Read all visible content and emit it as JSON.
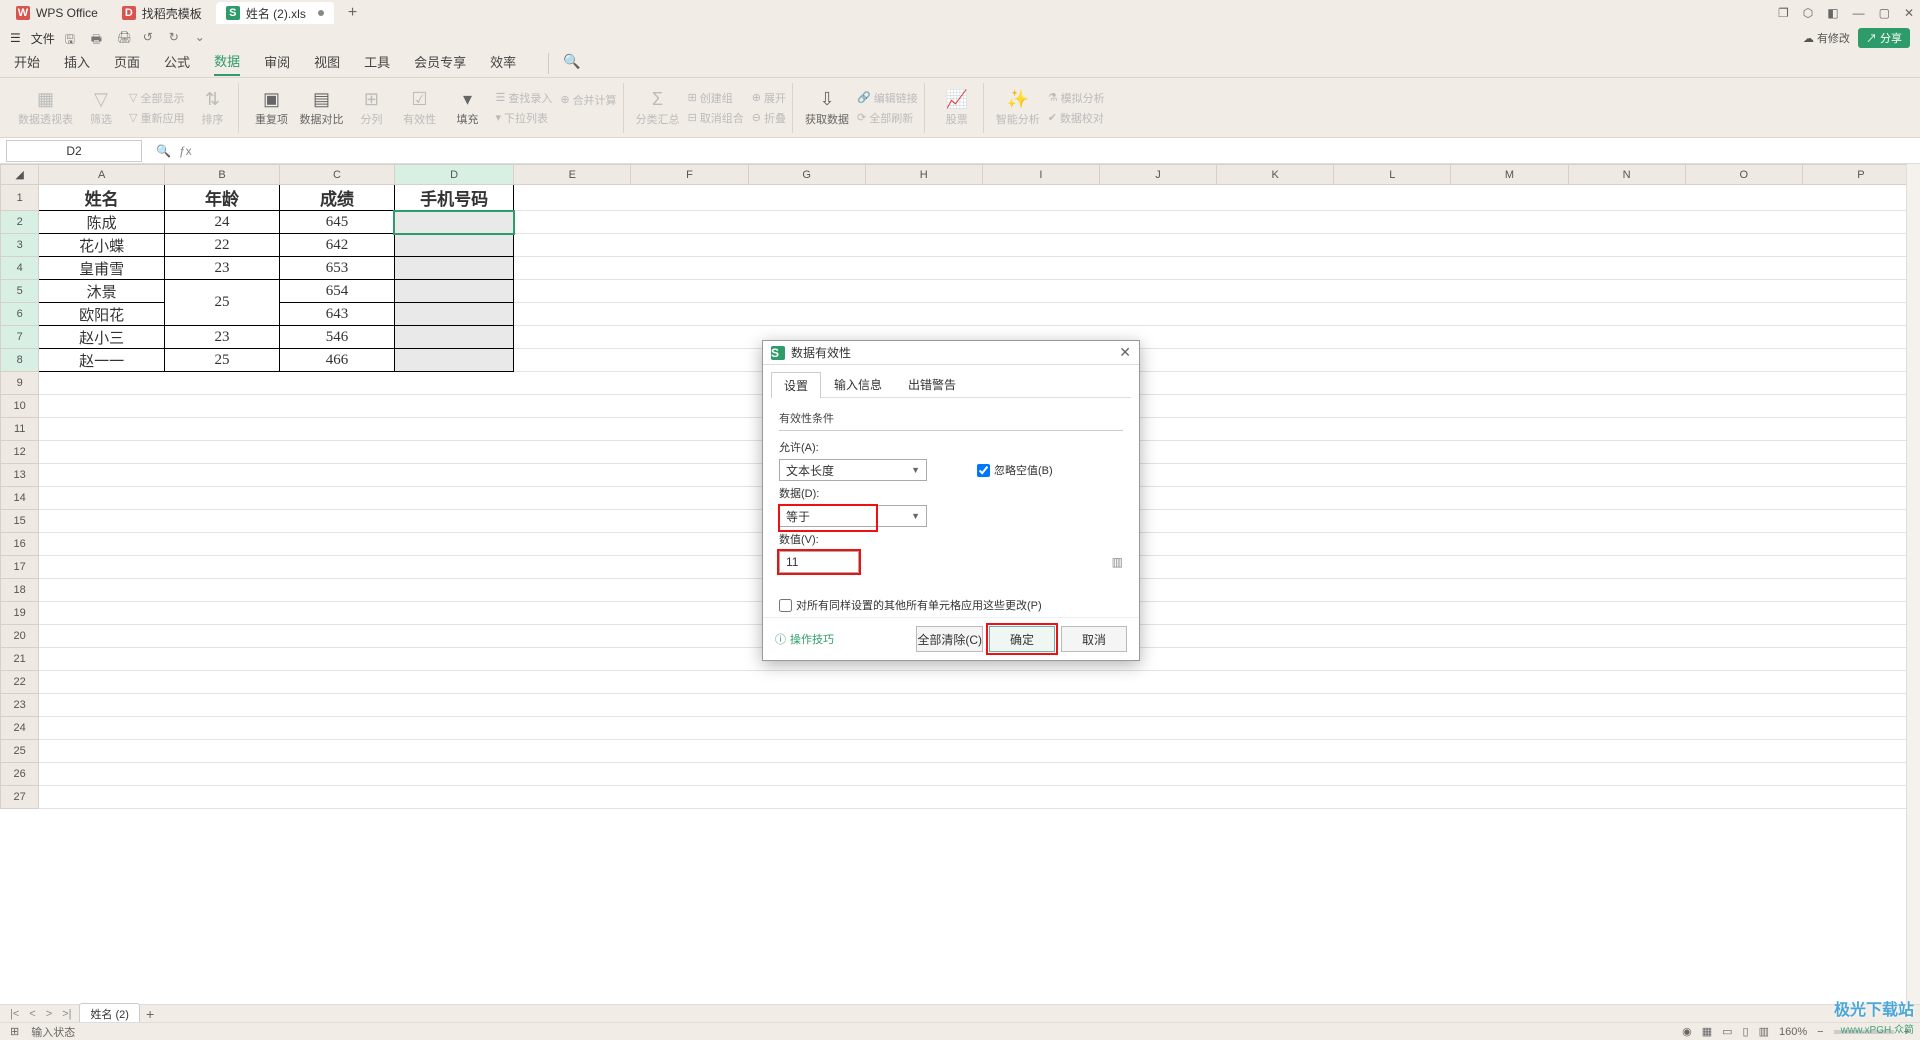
{
  "tabs": [
    {
      "icon": "W",
      "label": "WPS Office"
    },
    {
      "icon": "D",
      "label": "找稻壳模板"
    },
    {
      "icon": "S",
      "label": "姓名 (2).xls",
      "active": true,
      "dirty": true
    }
  ],
  "window_icons": [
    "❐",
    "⬡",
    "◧",
    "—",
    "▢",
    "✕"
  ],
  "file_menu": "文件",
  "qat": [
    "🖫",
    "🖶",
    "🖨",
    "↺",
    "↻"
  ],
  "mod_label": "有修改",
  "share_label": "分享",
  "ribbon_tabs": [
    "开始",
    "插入",
    "页面",
    "公式",
    "数据",
    "审阅",
    "视图",
    "工具",
    "会员专享",
    "效率"
  ],
  "ribbon_active": 4,
  "ribbon": {
    "pivot": "数据透视表",
    "filter": "筛选",
    "showall": "全部显示",
    "reapply": "重新应用",
    "sort": "排序",
    "dup": "重复项",
    "contrast": "数据对比",
    "split": "分列",
    "valid": "有效性",
    "fill": "填充",
    "dropdown": "下拉列表",
    "findrec": "查找录入",
    "consol": "合并计算",
    "subtotal": "分类汇总",
    "group": "创建组",
    "ungroup": "取消组合",
    "expand": "展开",
    "collapse": "折叠",
    "getdata": "获取数据",
    "editlink": "编辑链接",
    "refresh": "全部刷新",
    "stocks": "股票",
    "smart": "智能分析",
    "sim": "模拟分析",
    "datacheck": "数据校对"
  },
  "namebox": "D2",
  "columns": [
    "A",
    "B",
    "C",
    "D",
    "E",
    "F",
    "G",
    "H",
    "I",
    "J",
    "K",
    "L",
    "M",
    "N",
    "O",
    "P"
  ],
  "row_headers": [
    "1",
    "2",
    "3",
    "4",
    "5",
    "6",
    "7",
    "8",
    "9",
    "10",
    "11",
    "12",
    "13",
    "14",
    "15",
    "16",
    "17",
    "18",
    "19",
    "20",
    "21",
    "22",
    "23",
    "24",
    "25",
    "26",
    "27"
  ],
  "chart_data": {
    "type": "table",
    "headers": [
      "姓名",
      "年龄",
      "成绩",
      "手机号码"
    ],
    "rows": [
      [
        "陈成",
        "24",
        "645",
        ""
      ],
      [
        "花小蝶",
        "22",
        "642",
        ""
      ],
      [
        "皇甫雪",
        "23",
        "653",
        ""
      ],
      [
        "沐景",
        "25",
        "654",
        ""
      ],
      [
        "欧阳花",
        "",
        "643",
        ""
      ],
      [
        "赵小三",
        "23",
        "546",
        ""
      ],
      [
        "赵一一",
        "25",
        "466",
        ""
      ]
    ],
    "merged_age_rows": [
      3,
      4
    ]
  },
  "dialog": {
    "title": "数据有效性",
    "tabs": [
      "设置",
      "输入信息",
      "出错警告"
    ],
    "active_tab": 0,
    "legend": "有效性条件",
    "allow_label": "允许(A):",
    "allow_value": "文本长度",
    "ignore_label": "忽略空值(B)",
    "ignore_checked": true,
    "data_label": "数据(D):",
    "data_value": "等于",
    "value_label": "数值(V):",
    "value_value": "11",
    "apply_label": "对所有同样设置的其他所有单元格应用这些更改(P)",
    "apply_checked": false,
    "tip": "操作技巧",
    "clear": "全部清除(C)",
    "ok": "确定",
    "cancel": "取消"
  },
  "sheet_tab": "姓名 (2)",
  "status_text": "输入状态",
  "zoom": "160%",
  "watermark": "极光下载站",
  "watermark2": "www.xPGH 众简"
}
